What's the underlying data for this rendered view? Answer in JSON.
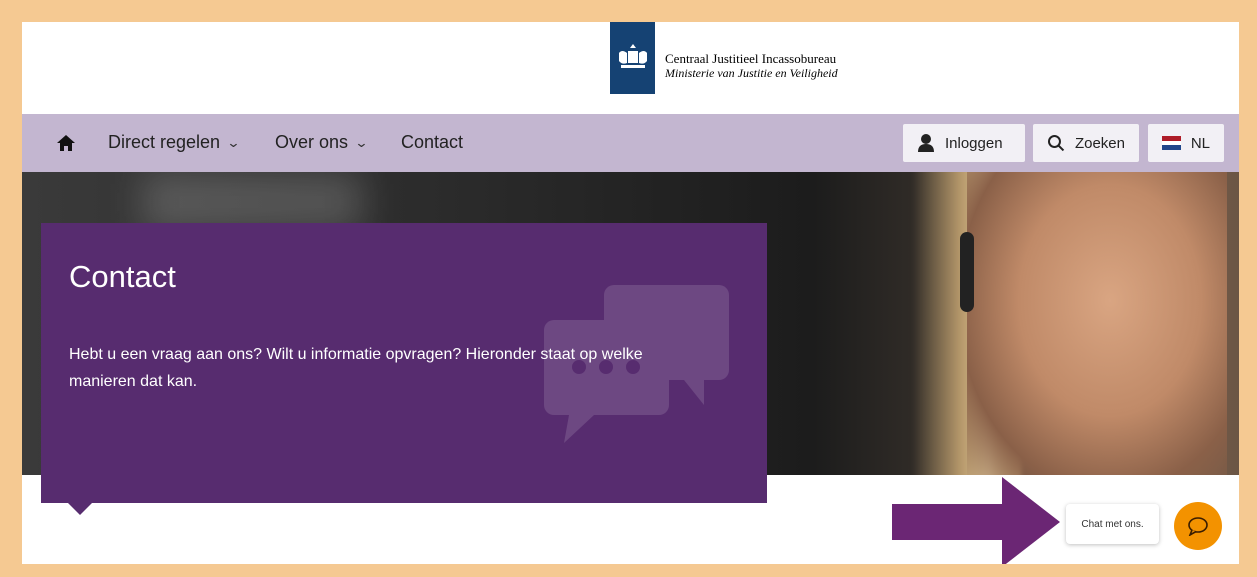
{
  "header": {
    "org_line1": "Centraal Justitieel Incassobureau",
    "org_line2": "Ministerie van Justitie en Veiligheid"
  },
  "nav": {
    "home_icon": "home-icon",
    "items": [
      {
        "label": "Direct regelen",
        "has_dropdown": true
      },
      {
        "label": "Over ons",
        "has_dropdown": true
      },
      {
        "label": "Contact",
        "has_dropdown": false
      }
    ],
    "buttons": {
      "login": "Inloggen",
      "search": "Zoeken",
      "language": "NL"
    }
  },
  "hero": {
    "title": "Contact",
    "text": "Hebt u een vraag aan ons? Wilt u informatie opvragen? Hieronder staat op welke manieren dat kan."
  },
  "chat": {
    "label": "Chat met ons.",
    "icon": "chat-icon"
  },
  "colors": {
    "outer_border": "#f5c992",
    "nav_bg": "#c3b6d0",
    "panel_purple": "#572c6f",
    "logo_blue": "#154273",
    "chat_orange": "#f39200",
    "arrow_purple": "#6b2674"
  }
}
